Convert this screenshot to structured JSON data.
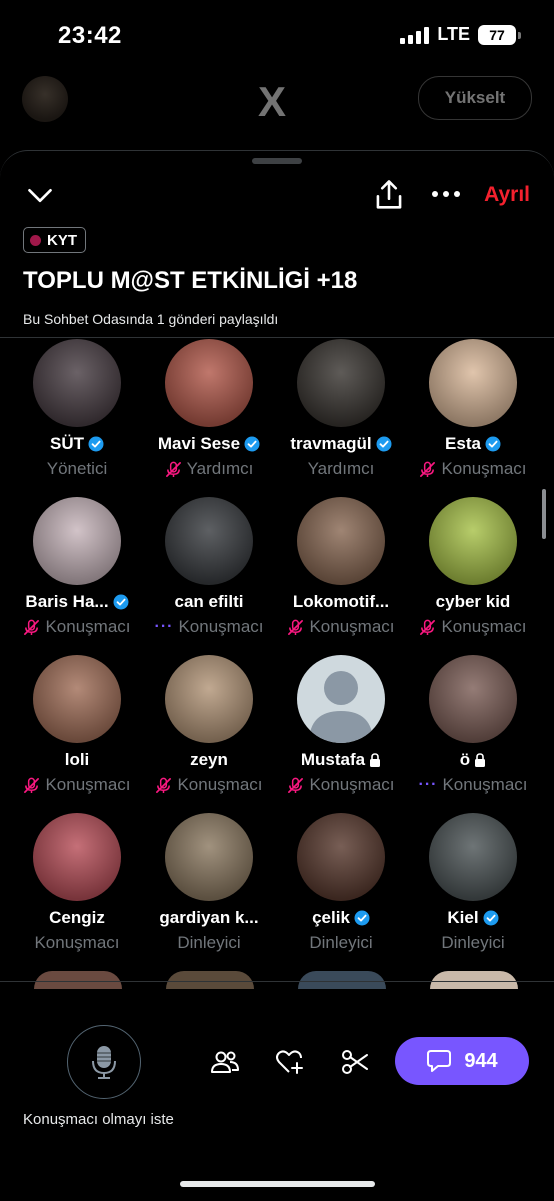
{
  "status_bar": {
    "time": "23:42",
    "network": "LTE",
    "battery": "77"
  },
  "background": {
    "logo": "X",
    "upgrade_label": "Yükselt"
  },
  "header": {
    "leave_label": "Ayrıl"
  },
  "room": {
    "tag": "KYT",
    "title": "TOPLU M@ST ETKİNLİGİ +18",
    "subtitle": "Bu Sohbet Odasında 1 gönderi paylaşıldı"
  },
  "participants": [
    {
      "name": "SÜT",
      "role": "Yönetici",
      "verified": true,
      "lock": false,
      "indicator": "none",
      "avatar_color": "#4a3f45"
    },
    {
      "name": "Mavi Sese",
      "role": "Yardımcı",
      "verified": true,
      "lock": false,
      "indicator": "mic-off",
      "avatar_color": "#b25a4c"
    },
    {
      "name": "travmagül",
      "role": "Yardımcı",
      "verified": true,
      "lock": false,
      "indicator": "none",
      "avatar_color": "#3b3733"
    },
    {
      "name": "Esta",
      "role": "Konuşmacı",
      "verified": true,
      "lock": false,
      "indicator": "mic-off",
      "avatar_color": "#d9b89a"
    },
    {
      "name": "Baris Ha...",
      "role": "Konuşmacı",
      "verified": true,
      "lock": false,
      "indicator": "mic-off",
      "avatar_color": "#c8b6bc"
    },
    {
      "name": "can efilti",
      "role": "Konuşmacı",
      "verified": false,
      "lock": false,
      "indicator": "dots",
      "avatar_color": "#3a3d41"
    },
    {
      "name": "Lokomotif...",
      "role": "Konuşmacı",
      "verified": false,
      "lock": false,
      "indicator": "mic-off",
      "avatar_color": "#8a6a55"
    },
    {
      "name": "cyber kid",
      "role": "Konuşmacı",
      "verified": false,
      "lock": false,
      "indicator": "mic-off",
      "avatar_color": "#a8c24a"
    },
    {
      "name": "loli",
      "role": "Konuşmacı",
      "verified": false,
      "lock": false,
      "indicator": "mic-off",
      "avatar_color": "#a2705a"
    },
    {
      "name": "zeyn",
      "role": "Konuşmacı",
      "verified": false,
      "lock": false,
      "indicator": "mic-off",
      "avatar_color": "#b39679"
    },
    {
      "name": "Mustafa",
      "role": "Konuşmacı",
      "verified": false,
      "lock": true,
      "indicator": "mic-off",
      "avatar_color": "#cfd9de"
    },
    {
      "name": "ö",
      "role": "Konuşmacı",
      "verified": false,
      "lock": true,
      "indicator": "dots",
      "avatar_color": "#7d5f58"
    },
    {
      "name": "Cengiz",
      "role": "Konuşmacı",
      "verified": false,
      "lock": false,
      "indicator": "none",
      "avatar_color": "#b8505a"
    },
    {
      "name": "gardiyan k...",
      "role": "Dinleyici",
      "verified": false,
      "lock": false,
      "indicator": "none",
      "avatar_color": "#8c7a62"
    },
    {
      "name": "çelik",
      "role": "Dinleyici",
      "verified": true,
      "lock": false,
      "indicator": "none",
      "avatar_color": "#5a3b30"
    },
    {
      "name": "Kiel",
      "role": "Dinleyici",
      "verified": true,
      "lock": false,
      "indicator": "none",
      "avatar_color": "#4e5658"
    }
  ],
  "footer": {
    "request_label": "Konuşmacı olmayı iste",
    "comment_count": "944"
  },
  "colors": {
    "accent": "#7856ff",
    "verified": "#1d9bf0",
    "leave": "#f4212e",
    "mic_off": "#f91880"
  }
}
